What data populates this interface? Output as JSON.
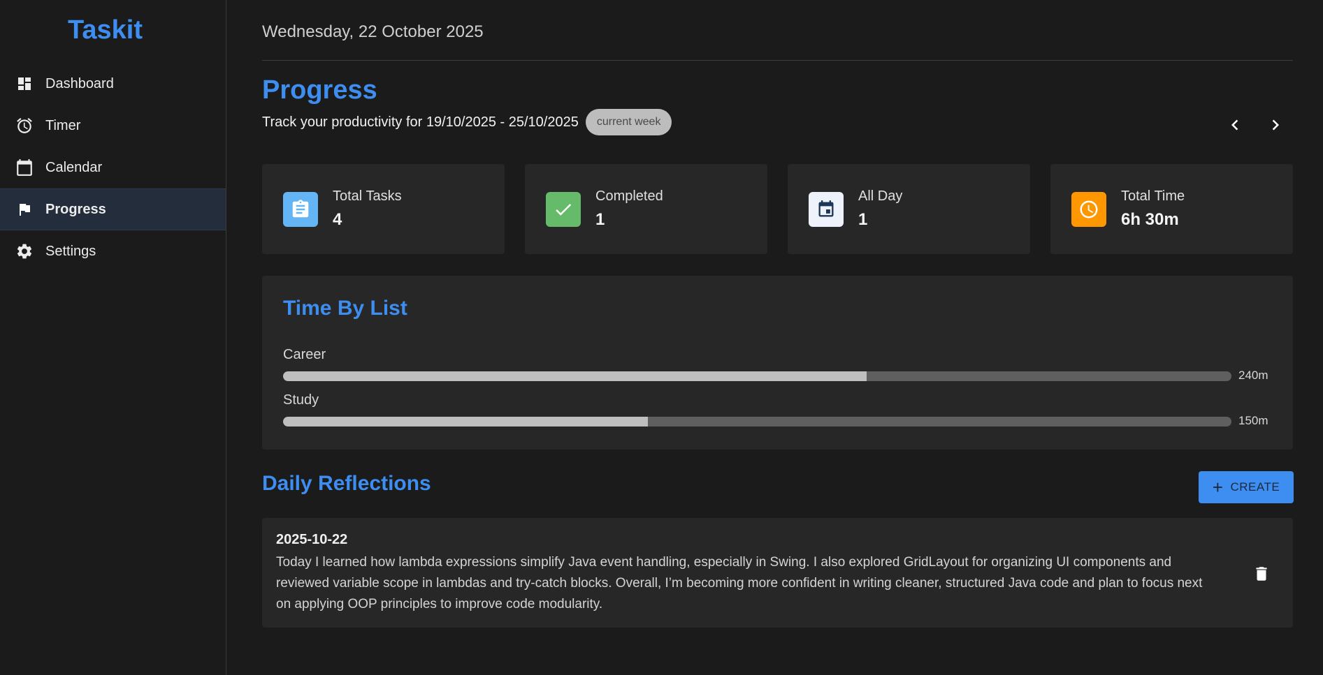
{
  "app": {
    "name": "Taskit"
  },
  "sidebar": {
    "items": [
      {
        "label": "Dashboard",
        "icon": "dashboard-icon"
      },
      {
        "label": "Timer",
        "icon": "alarm-clock-icon"
      },
      {
        "label": "Calendar",
        "icon": "calendar-icon"
      },
      {
        "label": "Progress",
        "icon": "flag-icon",
        "active": true
      },
      {
        "label": "Settings",
        "icon": "gear-icon"
      }
    ]
  },
  "header": {
    "date": "Wednesday, 22 October 2025"
  },
  "page": {
    "title": "Progress",
    "subtitle": "Track your productivity for 19/10/2025 - 25/10/2025",
    "week_chip": "current week"
  },
  "stats": [
    {
      "label": "Total Tasks",
      "value": "4",
      "icon": "clipboard-icon",
      "color": "#64b5f6"
    },
    {
      "label": "Completed",
      "value": "1",
      "icon": "check-icon",
      "color": "#66bb6a"
    },
    {
      "label": "All Day",
      "value": "1",
      "icon": "calendar-event-icon",
      "color": "#eef3fb"
    },
    {
      "label": "Total Time",
      "value": "6h 30m",
      "icon": "clock-icon",
      "color": "#ff9800"
    }
  ],
  "time_by_list": {
    "title": "Time By List",
    "items": [
      {
        "label": "Career",
        "value": "240m",
        "fill": 0.615
      },
      {
        "label": "Study",
        "value": "150m",
        "fill": 0.385
      }
    ]
  },
  "reflections": {
    "title": "Daily Reflections",
    "create_label": "CREATE",
    "entries": [
      {
        "date": "2025-10-22",
        "text": "Today I learned how lambda expressions simplify Java event handling, especially in Swing. I also explored GridLayout for organizing UI components and reviewed variable scope in lambdas and try-catch blocks. Overall, I’m becoming more confident in writing cleaner, structured Java code and plan to focus next on applying OOP principles to improve code modularity."
      }
    ]
  },
  "colors": {
    "accent": "#3d8ef0",
    "background": "#1b1b1b",
    "card": "#272727"
  }
}
